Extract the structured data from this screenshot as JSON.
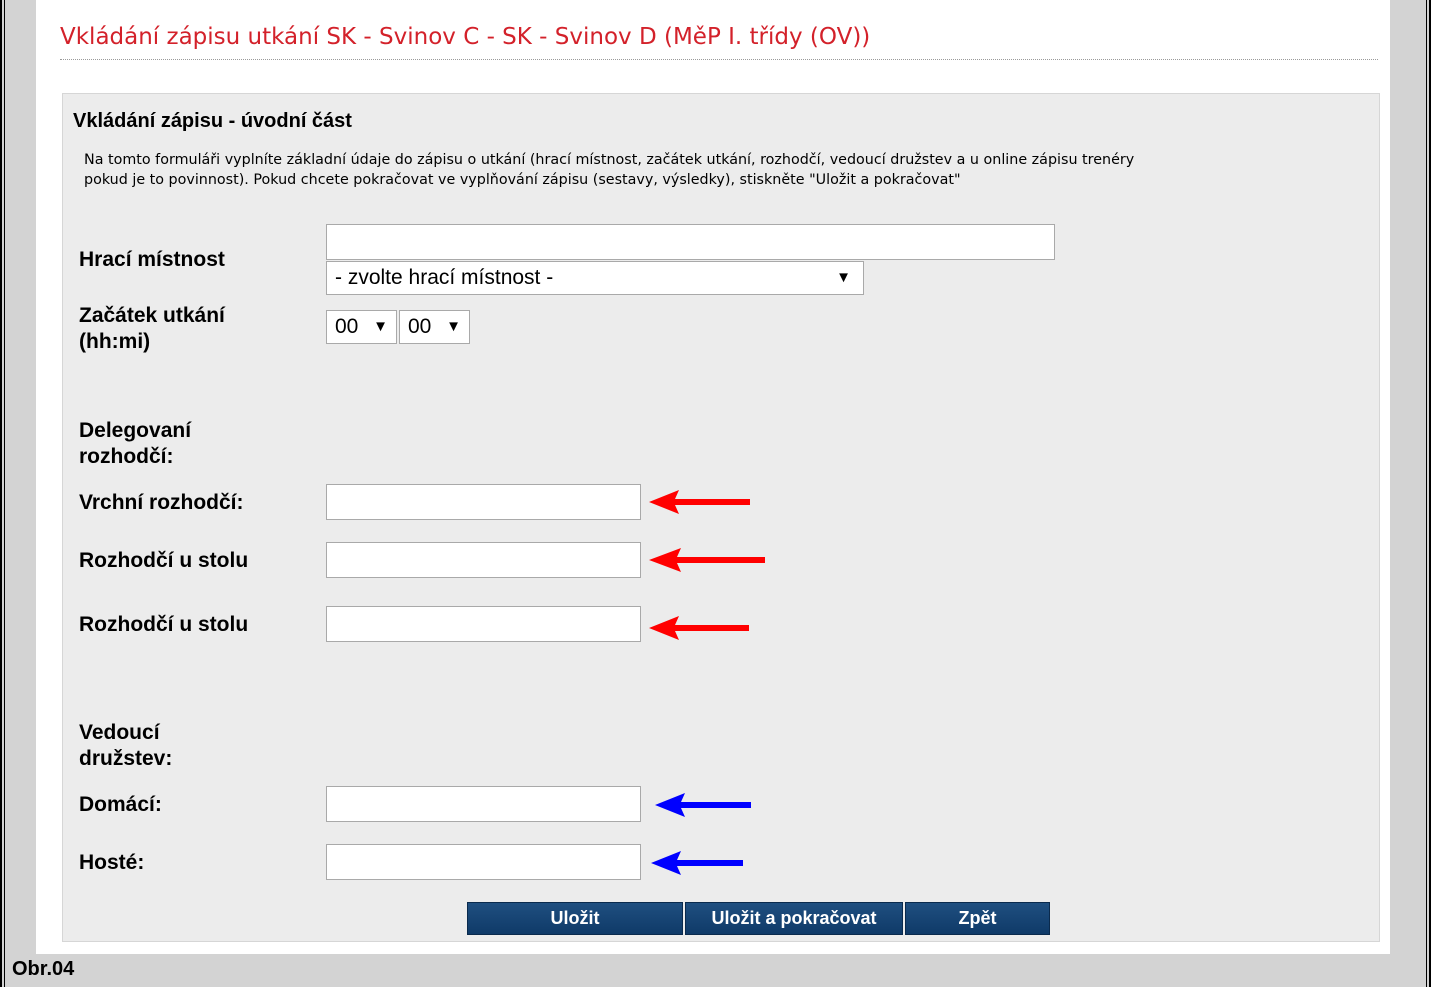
{
  "page_title": "Vkládání zápisu utkání SK - Svinov C - SK - Svinov D (MěP I. třídy (OV))",
  "section_title": "Vkládání zápisu - úvodní část",
  "intro_line1": "Na tomto formuláři vyplníte základní údaje do zápisu o utkání (hrací místnost, začátek utkání, rozhodčí, vedoucí družstev a u online zápisu trenéry",
  "intro_line2": "pokud je to povinnost). Pokud chcete pokračovat ve vyplňování zápisu (sestavy, výsledky), stiskněte \"Uložit a pokračovat\"",
  "venue": {
    "label": "Hrací místnost",
    "input_value": "",
    "select_value": "- zvolte hrací místnost -"
  },
  "start": {
    "label_line1": "Začátek utkání",
    "label_line2": "(hh:mi)",
    "hour": "00",
    "minute": "00"
  },
  "referees": {
    "heading_line1": "Delegovaní",
    "heading_line2": "rozhodčí:",
    "main_label": "Vrchní rozhodčí:",
    "table1_label": "Rozhodčí u stolu",
    "table2_label": "Rozhodčí u stolu",
    "main_value": "",
    "table1_value": "",
    "table2_value": ""
  },
  "leaders": {
    "heading_line1": "Vedoucí",
    "heading_line2": "družstev:",
    "home_label": "Domácí:",
    "away_label": "Hosté:",
    "home_value": "",
    "away_value": ""
  },
  "buttons": {
    "save": "Uložit",
    "save_continue": "Uložit a pokračovat",
    "back": "Zpět"
  },
  "caption": "Obr.04",
  "colors": {
    "title": "#d3212a",
    "referee_arrow": "#ff0000",
    "leader_arrow": "#0000ff",
    "button": "#163f6e"
  },
  "icons": {
    "select_caret": "▼",
    "referee_arrow": "arrow-left-red-icon",
    "leader_arrow": "arrow-left-blue-icon"
  }
}
